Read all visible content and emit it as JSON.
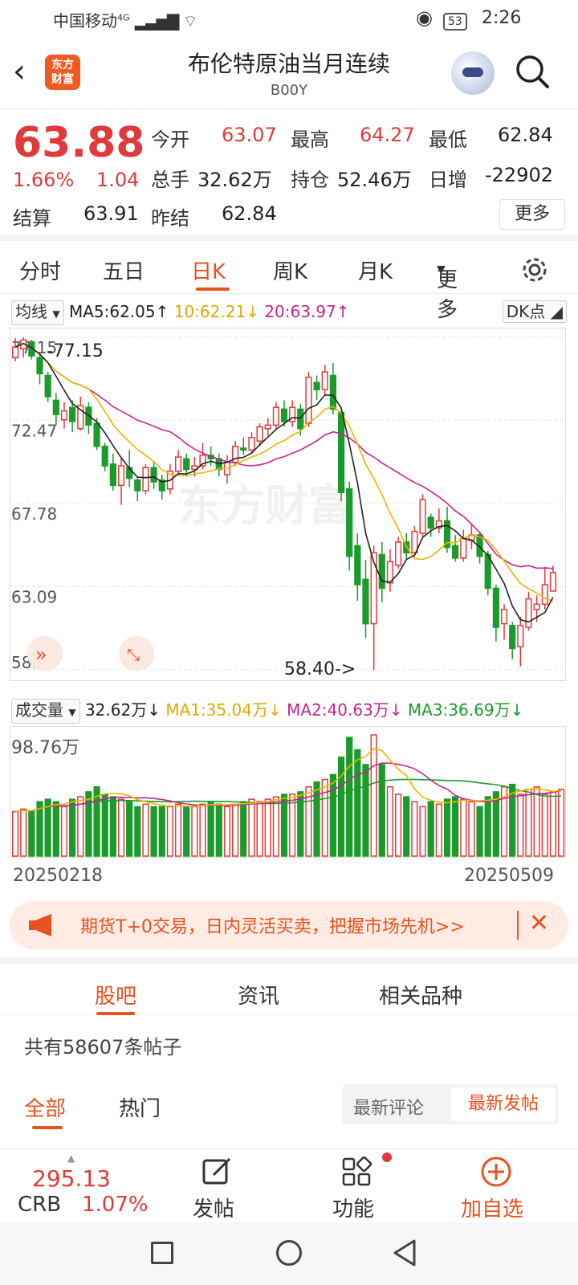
{
  "status_bar": {
    "carrier": "中国移动",
    "network": "4G",
    "battery": "53",
    "time": "2:26"
  },
  "header": {
    "logo_line1": "东方",
    "logo_line2": "财富",
    "title": "布伦特原油当月连续",
    "code": "B00Y"
  },
  "quote": {
    "price": "63.88",
    "change_pct": "1.66%",
    "change": "1.04",
    "open_label": "今开",
    "open": "63.07",
    "high_label": "最高",
    "high": "64.27",
    "low_label": "最低",
    "low": "62.84",
    "volume_label": "总手",
    "volume": "32.62万",
    "oi_label": "持仓",
    "oi": "52.46万",
    "daily_inc_label": "日增",
    "daily_inc": "-22902",
    "settle_label": "结算",
    "settle": "63.91",
    "prev_settle_label": "昨结",
    "prev_settle": "62.84",
    "more": "更多"
  },
  "chart_tabs": [
    "分时",
    "五日",
    "日K",
    "周K",
    "月K",
    "更多"
  ],
  "active_chart_tab": "日K",
  "ma_row": {
    "selector": "均线",
    "ma5": "MA5:62.05",
    "ma10": "10:62.21",
    "ma20": "20:63.97",
    "dk": "DK点"
  },
  "vol_row": {
    "selector": "成交量",
    "vol": "32.62万",
    "ma1": "MA1:35.04万",
    "ma2": "MA2:40.63万",
    "ma3": "MA3:36.69万"
  },
  "colors": {
    "up": "#e23a3a",
    "down": "#1a9b2c",
    "ma5": "#222222",
    "ma10": "#f0b400",
    "ma20": "#c4258f",
    "accent": "#e8521e"
  },
  "chart_data": {
    "type": "candlestick",
    "yticks": [
      "77.15",
      "72.47",
      "67.78",
      "63.09",
      "58.40"
    ],
    "ylim": [
      58.4,
      77.15
    ],
    "max_label": "-77.15",
    "min_label": "58.40->",
    "start_date": "20250218",
    "end_date": "20250509",
    "candles": [
      {
        "o": 76.0,
        "c": 76.6,
        "h": 77.1,
        "l": 75.8
      },
      {
        "o": 76.5,
        "c": 77.0,
        "h": 77.15,
        "l": 76.0
      },
      {
        "o": 76.9,
        "c": 76.1,
        "h": 77.0,
        "l": 75.9
      },
      {
        "o": 76.0,
        "c": 75.1,
        "h": 76.2,
        "l": 74.5
      },
      {
        "o": 75.0,
        "c": 73.8,
        "h": 75.2,
        "l": 73.5
      },
      {
        "o": 73.6,
        "c": 72.8,
        "h": 74.0,
        "l": 72.2
      },
      {
        "o": 72.5,
        "c": 73.0,
        "h": 73.5,
        "l": 72.0
      },
      {
        "o": 73.2,
        "c": 72.4,
        "h": 73.6,
        "l": 71.8
      },
      {
        "o": 72.0,
        "c": 73.3,
        "h": 73.8,
        "l": 71.9
      },
      {
        "o": 73.2,
        "c": 72.2,
        "h": 73.5,
        "l": 71.7
      },
      {
        "o": 72.3,
        "c": 71.0,
        "h": 72.6,
        "l": 70.8
      },
      {
        "o": 71.0,
        "c": 69.9,
        "h": 71.2,
        "l": 69.6
      },
      {
        "o": 70.0,
        "c": 68.8,
        "h": 70.6,
        "l": 68.5
      },
      {
        "o": 68.8,
        "c": 69.9,
        "h": 70.3,
        "l": 67.7
      },
      {
        "o": 69.8,
        "c": 69.2,
        "h": 70.8,
        "l": 68.7
      },
      {
        "o": 69.1,
        "c": 68.5,
        "h": 69.3,
        "l": 67.9
      },
      {
        "o": 68.5,
        "c": 69.8,
        "h": 70.0,
        "l": 68.3
      },
      {
        "o": 69.8,
        "c": 69.0,
        "h": 70.1,
        "l": 68.6
      },
      {
        "o": 69.1,
        "c": 68.5,
        "h": 69.4,
        "l": 68.0
      },
      {
        "o": 68.6,
        "c": 69.6,
        "h": 70.0,
        "l": 68.3
      },
      {
        "o": 69.6,
        "c": 70.4,
        "h": 70.8,
        "l": 69.4
      },
      {
        "o": 70.3,
        "c": 69.7,
        "h": 70.6,
        "l": 69.3
      },
      {
        "o": 69.7,
        "c": 69.9,
        "h": 70.4,
        "l": 69.3
      },
      {
        "o": 69.9,
        "c": 70.5,
        "h": 71.2,
        "l": 69.7
      },
      {
        "o": 70.5,
        "c": 70.3,
        "h": 71.0,
        "l": 69.9
      },
      {
        "o": 70.3,
        "c": 69.7,
        "h": 70.6,
        "l": 69.3
      },
      {
        "o": 69.4,
        "c": 70.1,
        "h": 70.5,
        "l": 68.9
      },
      {
        "o": 70.1,
        "c": 71.0,
        "h": 71.3,
        "l": 69.9
      },
      {
        "o": 70.9,
        "c": 70.8,
        "h": 71.5,
        "l": 70.5
      },
      {
        "o": 70.8,
        "c": 71.5,
        "h": 71.8,
        "l": 70.6
      },
      {
        "o": 71.3,
        "c": 72.1,
        "h": 72.3,
        "l": 71.0
      },
      {
        "o": 72.0,
        "c": 72.2,
        "h": 72.6,
        "l": 71.6
      },
      {
        "o": 72.2,
        "c": 73.2,
        "h": 73.5,
        "l": 72.0
      },
      {
        "o": 73.1,
        "c": 72.4,
        "h": 73.6,
        "l": 72.1
      },
      {
        "o": 72.4,
        "c": 73.2,
        "h": 73.6,
        "l": 72.1
      },
      {
        "o": 73.1,
        "c": 72.0,
        "h": 73.4,
        "l": 71.6
      },
      {
        "o": 72.3,
        "c": 74.9,
        "h": 75.2,
        "l": 72.1
      },
      {
        "o": 74.6,
        "c": 74.2,
        "h": 75.0,
        "l": 73.6
      },
      {
        "o": 74.2,
        "c": 75.2,
        "h": 75.6,
        "l": 73.9
      },
      {
        "o": 75.0,
        "c": 73.1,
        "h": 75.7,
        "l": 72.8
      },
      {
        "o": 72.9,
        "c": 68.4,
        "h": 73.0,
        "l": 67.9
      },
      {
        "o": 68.6,
        "c": 64.8,
        "h": 69.0,
        "l": 64.0
      },
      {
        "o": 65.4,
        "c": 63.2,
        "h": 66.1,
        "l": 62.3
      },
      {
        "o": 63.5,
        "c": 61.0,
        "h": 64.6,
        "l": 60.2
      },
      {
        "o": 61.0,
        "c": 65.0,
        "h": 65.4,
        "l": 58.4
      },
      {
        "o": 64.9,
        "c": 63.0,
        "h": 65.6,
        "l": 62.2
      },
      {
        "o": 63.3,
        "c": 64.5,
        "h": 65.2,
        "l": 62.8
      },
      {
        "o": 64.3,
        "c": 65.6,
        "h": 65.9,
        "l": 64.1
      },
      {
        "o": 65.6,
        "c": 65.0,
        "h": 66.1,
        "l": 64.6
      },
      {
        "o": 65.0,
        "c": 66.2,
        "h": 66.5,
        "l": 64.8
      },
      {
        "o": 66.1,
        "c": 68.0,
        "h": 68.3,
        "l": 65.9
      },
      {
        "o": 67.0,
        "c": 66.4,
        "h": 67.2,
        "l": 65.9
      },
      {
        "o": 66.4,
        "c": 66.8,
        "h": 67.5,
        "l": 66.1
      },
      {
        "o": 66.8,
        "c": 65.3,
        "h": 67.6,
        "l": 65.0
      },
      {
        "o": 65.4,
        "c": 64.7,
        "h": 66.0,
        "l": 64.5
      },
      {
        "o": 64.7,
        "c": 65.8,
        "h": 66.3,
        "l": 64.5
      },
      {
        "o": 65.7,
        "c": 66.0,
        "h": 66.6,
        "l": 65.2
      },
      {
        "o": 66.0,
        "c": 64.8,
        "h": 66.2,
        "l": 64.4
      },
      {
        "o": 64.9,
        "c": 63.0,
        "h": 65.1,
        "l": 62.6
      },
      {
        "o": 63.0,
        "c": 60.8,
        "h": 63.2,
        "l": 60.0
      },
      {
        "o": 61.0,
        "c": 61.8,
        "h": 62.1,
        "l": 60.1
      },
      {
        "o": 60.9,
        "c": 59.6,
        "h": 61.1,
        "l": 59.0
      },
      {
        "o": 59.7,
        "c": 60.9,
        "h": 61.4,
        "l": 58.6
      },
      {
        "o": 60.8,
        "c": 62.4,
        "h": 62.8,
        "l": 60.6
      },
      {
        "o": 61.8,
        "c": 62.1,
        "h": 62.6,
        "l": 61.1
      },
      {
        "o": 62.1,
        "c": 63.2,
        "h": 64.2,
        "l": 61.8
      },
      {
        "o": 62.84,
        "c": 63.88,
        "h": 64.27,
        "l": 62.84
      }
    ],
    "volume": {
      "ylabel": "98.76万",
      "values": [
        36,
        38,
        36,
        44,
        46,
        44,
        40,
        46,
        48,
        52,
        56,
        50,
        48,
        46,
        44,
        40,
        42,
        40,
        40,
        40,
        42,
        40,
        40,
        42,
        44,
        42,
        40,
        42,
        44,
        46,
        44,
        46,
        48,
        50,
        50,
        52,
        56,
        60,
        62,
        66,
        80,
        96,
        86,
        74,
        98,
        74,
        56,
        50,
        48,
        44,
        40,
        44,
        42,
        46,
        48,
        46,
        44,
        40,
        48,
        52,
        56,
        58,
        50,
        54,
        56,
        50,
        52,
        54
      ]
    },
    "x_tick_labels": []
  },
  "banner": {
    "text": "期货T+0交易，日内灵活买卖，把握市场先机>>"
  },
  "lower_tabs": [
    "股吧",
    "资讯",
    "相关品种"
  ],
  "active_lower_tab": "股吧",
  "post_count": "共有58607条帖子",
  "filters": {
    "all": "全部",
    "hot": "热门",
    "latest_comment": "最新评论",
    "latest_post": "最新发帖"
  },
  "bottom_bar": {
    "index_value": "295.13",
    "index_name": "CRB",
    "index_pct": "1.07%",
    "post": "发帖",
    "func": "功能",
    "add": "加自选"
  }
}
